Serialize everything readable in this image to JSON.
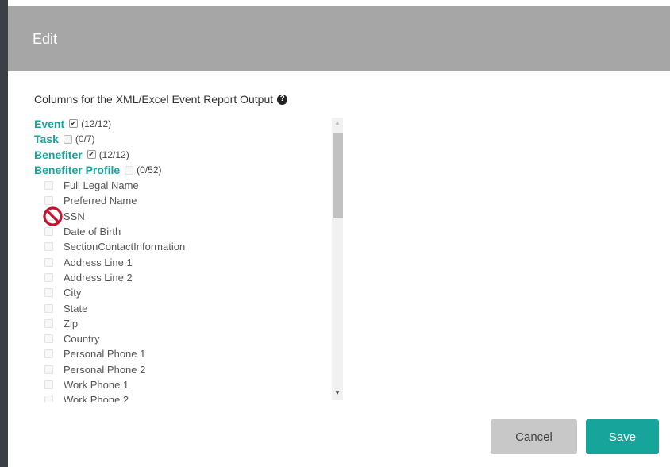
{
  "dialog": {
    "title": "Edit",
    "section_label": "Columns for the XML/Excel Event Report Output",
    "help_icon_symbol": "?"
  },
  "groups": [
    {
      "name": "Event",
      "checked": true,
      "count": "(12/12)"
    },
    {
      "name": "Task",
      "checked": false,
      "count": "(0/7)"
    },
    {
      "name": "Benefiter",
      "checked": true,
      "count": "(12/12)"
    },
    {
      "name": "Benefiter Profile",
      "checked": false,
      "count": "(0/52)"
    }
  ],
  "profile_fields": [
    "Full Legal Name",
    "Preferred Name",
    "SSN",
    "Date of Birth",
    "SectionContactInformation",
    "Address Line 1",
    "Address Line 2",
    "City",
    "State",
    "Zip",
    "Country",
    "Personal Phone 1",
    "Personal Phone 2",
    "Work Phone 1",
    "Work Phone 2"
  ],
  "buttons": {
    "cancel": "Cancel",
    "save": "Save"
  },
  "colors": {
    "header_bg": "#a6a6a6",
    "accent": "#17a59b",
    "cancel_bg": "#c8c8c8"
  },
  "icons": {
    "cursor": "not-allowed-cursor-icon",
    "help": "help-icon"
  }
}
